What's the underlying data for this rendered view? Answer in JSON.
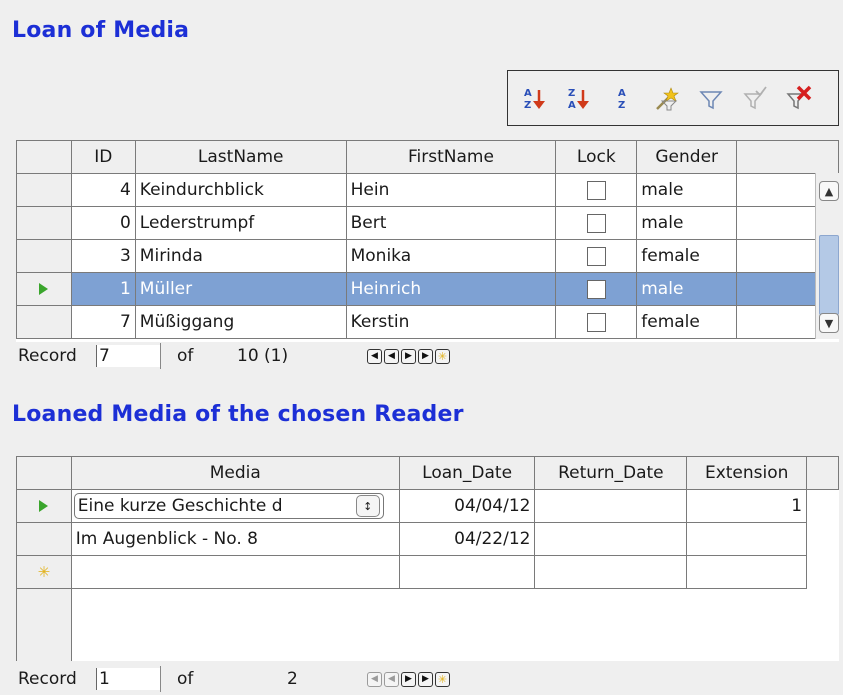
{
  "form": {
    "title_main": "Loan of Media",
    "title_sub": "Loaned Media of the chosen Reader"
  },
  "toolbar": {
    "buttons": [
      {
        "name": "sort-ascending-icon",
        "label": "Sort Ascending"
      },
      {
        "name": "sort-descending-icon",
        "label": "Sort Descending"
      },
      {
        "name": "sort-icon",
        "label": "Sort"
      },
      {
        "name": "autofilter-icon",
        "label": "AutoFilter"
      },
      {
        "name": "standard-filter-icon",
        "label": "Standard Filter"
      },
      {
        "name": "apply-filter-icon",
        "label": "Apply Filter"
      },
      {
        "name": "remove-filter-icon",
        "label": "Remove Filter"
      }
    ]
  },
  "readers_grid": {
    "columns": [
      "ID",
      "LastName",
      "FirstName",
      "Lock",
      "Gender"
    ],
    "rows": [
      {
        "id": "4",
        "lastname": "Keindurchblick",
        "firstname": "Hein",
        "gender": "male"
      },
      {
        "id": "0",
        "lastname": "Lederstrumpf",
        "firstname": "Bert",
        "gender": "male"
      },
      {
        "id": "3",
        "lastname": "Mirinda",
        "firstname": "Monika",
        "gender": "female"
      },
      {
        "id": "1",
        "lastname": "Müller",
        "firstname": "Heinrich",
        "gender": "male"
      },
      {
        "id": "7",
        "lastname": "Müßiggang",
        "firstname": "Kerstin",
        "gender": "female"
      }
    ],
    "selected_row": 3,
    "nav": {
      "record_label": "Record",
      "record_value": "7",
      "of_label": "of",
      "total": "10 (1)"
    }
  },
  "media_grid": {
    "columns": [
      "Media",
      "Loan_Date",
      "Return_Date",
      "Extension"
    ],
    "rows": [
      {
        "media": "Eine kurze Geschichte d",
        "loan_date": "04/04/12",
        "return_date": "",
        "extension": "1"
      },
      {
        "media": "Im Augenblick - No. 8",
        "loan_date": "04/22/12",
        "return_date": "",
        "extension": ""
      }
    ],
    "nav": {
      "record_label": "Record",
      "record_value": "1",
      "of_label": "of",
      "total": "2"
    }
  },
  "colors": {
    "title": "#1c2fd6",
    "selection": "#7ea1d3",
    "current_row_arrow": "#3aa52c",
    "new_record_star": "#e2b21b"
  }
}
